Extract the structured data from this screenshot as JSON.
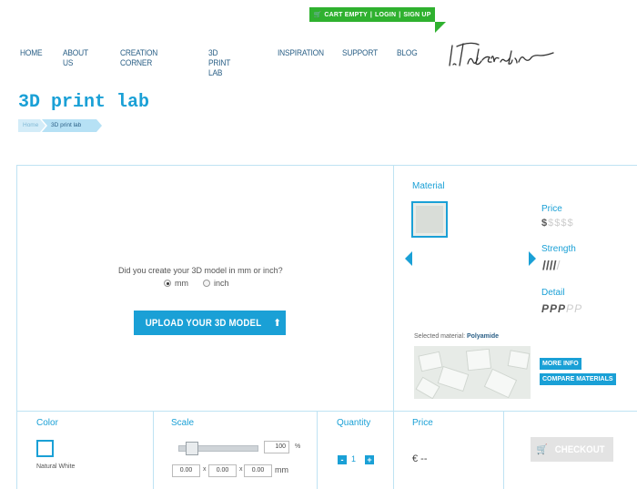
{
  "top_bar": {
    "cart": "CART EMPTY",
    "sep1": "|",
    "login": "LOGIN",
    "sep2": "|",
    "signup": "SIGN UP"
  },
  "nav": {
    "items": [
      "HOME",
      "ABOUT US",
      "CREATION CORNER",
      "3D PRINT LAB",
      "INSPIRATION",
      "SUPPORT",
      "BLOG"
    ]
  },
  "logo": "i.Materialise",
  "page_title": "3D print lab",
  "breadcrumb": [
    "Home",
    "3D print lab"
  ],
  "upload": {
    "question": "Did you create your 3D model in mm or inch?",
    "unit_mm": "mm",
    "unit_inch": "inch",
    "selected_unit": "mm",
    "button_label": "UPLOAD YOUR 3D MODEL"
  },
  "material": {
    "label": "Material",
    "price_label": "Price",
    "price_rating": 1,
    "price_symbol": "$",
    "strength_label": "Strength",
    "strength_rating": 4,
    "detail_label": "Detail",
    "detail_rating": 3,
    "rating_max": 5,
    "selected_prefix": "Selected material:",
    "selected_name": "Polyamide",
    "more_info": "MORE INFO",
    "compare": "COMPARE MATERIALS"
  },
  "bottom": {
    "color_label": "Color",
    "color_name": "Natural White",
    "scale_label": "Scale",
    "scale_value": "100",
    "scale_unit": "%",
    "dims": [
      "0.00",
      "0.00",
      "0.00"
    ],
    "dim_sep": "x",
    "dim_unit": "mm",
    "quantity_label": "Quantity",
    "quantity_value": "1",
    "qty_minus": "-",
    "qty_plus": "+",
    "price_label": "Price",
    "price_value": "€ --",
    "checkout_label": "CHECKOUT"
  },
  "colors": {
    "accent": "#1aa0d6",
    "cart_green": "#2fb12f",
    "nav_text": "#2a5f86",
    "border": "#bfe3f3",
    "disabled": "#e3e3e3"
  }
}
